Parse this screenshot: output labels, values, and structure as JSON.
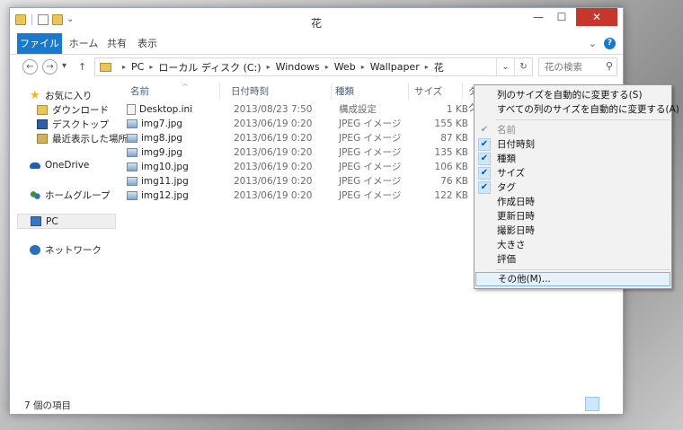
{
  "window": {
    "title": "花",
    "close_glyph": "✕",
    "minimize_glyph": "—",
    "maximize_glyph": "☐"
  },
  "ribbon": {
    "tabs": [
      "ファイル",
      "ホーム",
      "共有",
      "表示"
    ],
    "expand_glyph": "⌄",
    "help_glyph": "?"
  },
  "address": {
    "back_glyph": "←",
    "forward_glyph": "→",
    "dropdown_glyph": "▾",
    "up_glyph": "↑",
    "crumbs": [
      "PC",
      "ローカル ディスク (C:)",
      "Windows",
      "Web",
      "Wallpaper",
      "花"
    ],
    "crumb_separator": "▸",
    "history_glyph": "⌄",
    "refresh_glyph": "↻",
    "search_placeholder": "花の検索",
    "search_glyph": "⚲"
  },
  "navigation": {
    "favorites": "お気に入り",
    "downloads": "ダウンロード",
    "desktop": "デスクトップ",
    "recent": "最近表示した場所",
    "onedrive": "OneDrive",
    "homegroup": "ホームグループ",
    "pc": "PC",
    "network": "ネットワーク"
  },
  "columns": {
    "name": "名前",
    "date": "日付時刻",
    "type": "種類",
    "size": "サイズ",
    "tags": "タグ",
    "sort_glyph": "^"
  },
  "files": [
    {
      "name": "Desktop.ini",
      "date": "2013/08/23 7:50",
      "type": "構成設定",
      "size": "1 KB",
      "icon": "ini-file-icon"
    },
    {
      "name": "img7.jpg",
      "date": "2013/06/19 0:20",
      "type": "JPEG イメージ",
      "size": "155 KB",
      "icon": "image-file-icon"
    },
    {
      "name": "img8.jpg",
      "date": "2013/06/19 0:20",
      "type": "JPEG イメージ",
      "size": "87 KB",
      "icon": "image-file-icon"
    },
    {
      "name": "img9.jpg",
      "date": "2013/06/19 0:20",
      "type": "JPEG イメージ",
      "size": "135 KB",
      "icon": "image-file-icon"
    },
    {
      "name": "img10.jpg",
      "date": "2013/06/19 0:20",
      "type": "JPEG イメージ",
      "size": "106 KB",
      "icon": "image-file-icon"
    },
    {
      "name": "img11.jpg",
      "date": "2013/06/19 0:20",
      "type": "JPEG イメージ",
      "size": "76 KB",
      "icon": "image-file-icon"
    },
    {
      "name": "img12.jpg",
      "date": "2013/06/19 0:20",
      "type": "JPEG イメージ",
      "size": "122 KB",
      "icon": "image-file-icon"
    }
  ],
  "status": {
    "item_count": "7 個の項目"
  },
  "context_menu": {
    "check_glyph": "✔",
    "size_column": "列のサイズを自動的に変更する(S)",
    "size_all_columns": "すべての列のサイズを自動的に変更する(A)",
    "name": "名前",
    "date": "日付時刻",
    "type": "種類",
    "size": "サイズ",
    "tags": "タグ",
    "created": "作成日時",
    "modified": "更新日時",
    "date_taken": "撮影日時",
    "dimensions": "大きさ",
    "rating": "評価",
    "more": "その他(M)..."
  },
  "colors": {
    "accent": "#1979ca",
    "close_red": "#c7362b",
    "menu_highlight": "#e5f1fb",
    "check_bg": "#cce8ff"
  }
}
